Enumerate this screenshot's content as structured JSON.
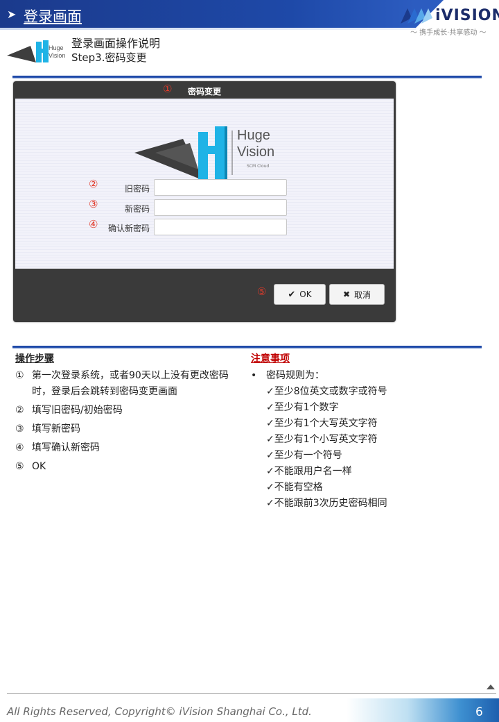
{
  "header": {
    "arrow": "➤",
    "title": "登录画面",
    "brand_name": "iVISION",
    "brand_slogan": "～ 携手成长·共享感动 ～"
  },
  "subheader": {
    "title": "登录画面操作说明",
    "step": "Step3.密码变更"
  },
  "dialog": {
    "title": "密码变更",
    "logo_text_1": "Huge",
    "logo_text_2": "Vision",
    "logo_text_3": "SCM Cloud",
    "markers": [
      "①",
      "②",
      "③",
      "④",
      "⑤"
    ],
    "fields": [
      {
        "label": "旧密码",
        "value": ""
      },
      {
        "label": "新密码",
        "value": ""
      },
      {
        "label": "确认新密码",
        "value": ""
      }
    ],
    "ok_label": "OK",
    "cancel_label": "取消"
  },
  "steps": {
    "heading": "操作步骤",
    "items": [
      {
        "num": "①",
        "text": "第一次登录系统，或者90天以上没有更改密码时，登录后会跳转到密码变更画面"
      },
      {
        "num": "②",
        "text": "填写旧密码/初始密码"
      },
      {
        "num": "③",
        "text": "填写新密码"
      },
      {
        "num": "④",
        "text": "填写确认新密码"
      },
      {
        "num": "⑤",
        "text": "OK"
      }
    ]
  },
  "notes": {
    "heading": "注意事项",
    "bullet": "•",
    "intro": "密码规则为：",
    "rules": [
      "✓至少8位英文或数字或符号",
      "✓至少有1个数字",
      "✓至少有1个大写英文字符",
      "✓至少有1个小写英文字符",
      "✓至少有一个符号",
      "✓不能跟用户名一样",
      "✓不能有空格",
      "✓不能跟前3次历史密码相同"
    ]
  },
  "footer": {
    "copyright": "All Rights Reserved, Copyright© iVision Shanghai Co., Ltd.",
    "page": "6"
  },
  "colors": {
    "header_blue": "#1e49a8",
    "marker_red": "#e23a2a",
    "notes_heading_red": "#c00000",
    "logo_cyan": "#1fb3e6"
  }
}
